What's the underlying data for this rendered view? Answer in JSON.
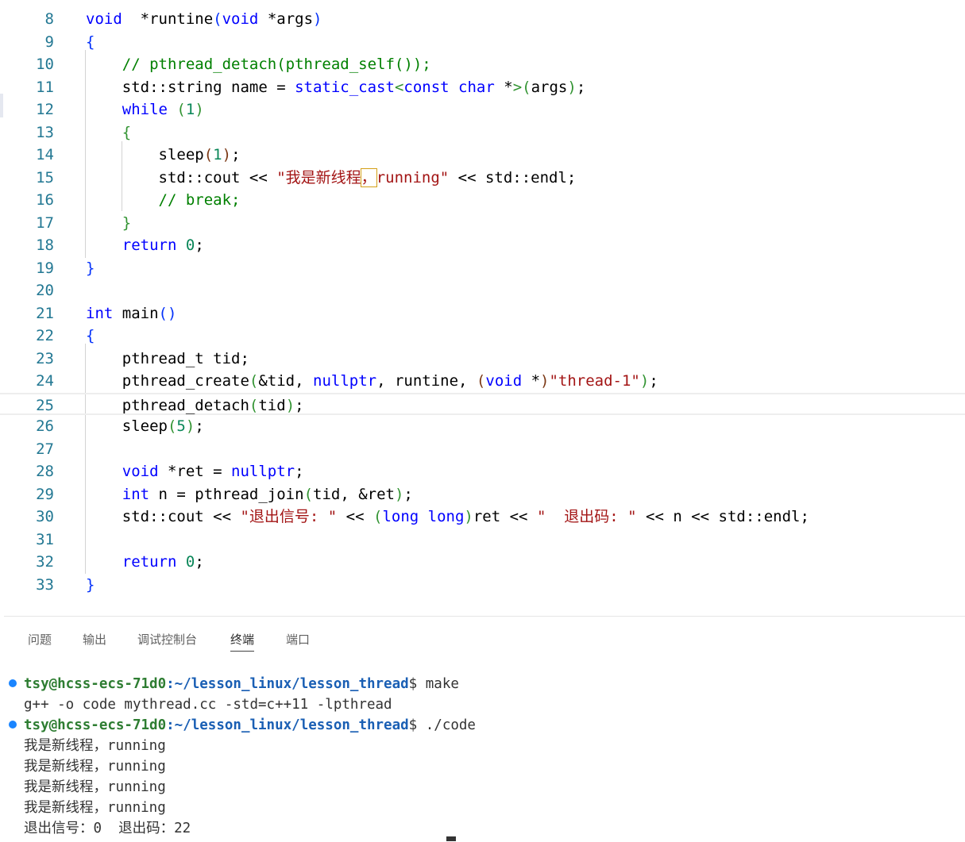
{
  "editor": {
    "lines": [
      {
        "n": "8",
        "tokens": [
          [
            "kw",
            "void"
          ],
          [
            "",
            "  *runtine"
          ],
          [
            "br1",
            "("
          ],
          [
            "kw",
            "void"
          ],
          [
            "",
            " *args"
          ],
          [
            "br1",
            ")"
          ]
        ]
      },
      {
        "n": "9",
        "tokens": [
          [
            "br1",
            "{"
          ]
        ]
      },
      {
        "n": "10",
        "tokens": [
          [
            "",
            "    "
          ],
          [
            "cm",
            "// pthread_detach(pthread_self());"
          ]
        ]
      },
      {
        "n": "11",
        "tokens": [
          [
            "",
            "    std::string name = "
          ],
          [
            "kw",
            "static_cast"
          ],
          [
            "br2",
            "<"
          ],
          [
            "kw",
            "const char"
          ],
          [
            "",
            " *"
          ],
          [
            "br2",
            ">"
          ],
          [
            "br2",
            "("
          ],
          [
            "",
            "args"
          ],
          [
            "br2",
            ")"
          ],
          [
            "",
            ";"
          ]
        ]
      },
      {
        "n": "12",
        "tokens": [
          [
            "",
            "    "
          ],
          [
            "kw",
            "while"
          ],
          [
            "",
            ""
          ],
          [
            "br2",
            " ("
          ],
          [
            "num",
            "1"
          ],
          [
            "br2",
            ")"
          ]
        ]
      },
      {
        "n": "13",
        "tokens": [
          [
            "",
            "    "
          ],
          [
            "br2",
            "{"
          ]
        ]
      },
      {
        "n": "14",
        "tokens": [
          [
            "",
            "        sleep"
          ],
          [
            "br3",
            "("
          ],
          [
            "num",
            "1"
          ],
          [
            "br3",
            ")"
          ],
          [
            "",
            ";"
          ]
        ]
      },
      {
        "n": "15",
        "tokens": [
          [
            "",
            "        std::cout << "
          ],
          [
            "str",
            "\"我是新线程"
          ],
          [
            "str sel",
            "，"
          ],
          [
            "str",
            "running\""
          ],
          [
            "",
            " << std::endl;"
          ]
        ]
      },
      {
        "n": "16",
        "tokens": [
          [
            "",
            "        "
          ],
          [
            "cm",
            "// break;"
          ]
        ]
      },
      {
        "n": "17",
        "tokens": [
          [
            "",
            "    "
          ],
          [
            "br2",
            "}"
          ]
        ]
      },
      {
        "n": "18",
        "tokens": [
          [
            "",
            "    "
          ],
          [
            "kw",
            "return"
          ],
          [
            "",
            " "
          ],
          [
            "num",
            "0"
          ],
          [
            "",
            ";"
          ]
        ]
      },
      {
        "n": "19",
        "tokens": [
          [
            "br1",
            "}"
          ]
        ]
      },
      {
        "n": "20",
        "tokens": []
      },
      {
        "n": "21",
        "tokens": [
          [
            "kw",
            "int"
          ],
          [
            "",
            " main"
          ],
          [
            "br1",
            "()"
          ]
        ]
      },
      {
        "n": "22",
        "tokens": [
          [
            "br1",
            "{"
          ]
        ]
      },
      {
        "n": "23",
        "tokens": [
          [
            "",
            "    pthread_t tid;"
          ]
        ]
      },
      {
        "n": "24",
        "tokens": [
          [
            "",
            "    pthread_create"
          ],
          [
            "br2",
            "("
          ],
          [
            "",
            "&tid, "
          ],
          [
            "kw",
            "nullptr"
          ],
          [
            "",
            ", runtine, "
          ],
          [
            "br3",
            "("
          ],
          [
            "kw",
            "void"
          ],
          [
            "",
            " *"
          ],
          [
            "br3",
            ")"
          ],
          [
            "str",
            "\"thread-1\""
          ],
          [
            "br2",
            ")"
          ],
          [
            "",
            ";"
          ]
        ]
      },
      {
        "n": "25",
        "tokens": [
          [
            "",
            "    pthread_detach"
          ],
          [
            "br2",
            "("
          ],
          [
            "",
            "tid"
          ],
          [
            "br2",
            ")"
          ],
          [
            "",
            ";"
          ]
        ]
      },
      {
        "n": "26",
        "tokens": [
          [
            "",
            "    sleep"
          ],
          [
            "br2",
            "("
          ],
          [
            "num",
            "5"
          ],
          [
            "br2",
            ")"
          ],
          [
            "",
            ";"
          ]
        ]
      },
      {
        "n": "27",
        "tokens": []
      },
      {
        "n": "28",
        "tokens": [
          [
            "",
            "    "
          ],
          [
            "kw",
            "void"
          ],
          [
            "",
            " *ret = "
          ],
          [
            "kw",
            "nullptr"
          ],
          [
            "",
            ";"
          ]
        ]
      },
      {
        "n": "29",
        "tokens": [
          [
            "",
            "    "
          ],
          [
            "kw",
            "int"
          ],
          [
            "",
            " n = pthread_join"
          ],
          [
            "br2",
            "("
          ],
          [
            "",
            "tid, &ret"
          ],
          [
            "br2",
            ")"
          ],
          [
            "",
            ";"
          ]
        ]
      },
      {
        "n": "30",
        "tokens": [
          [
            "",
            "    std::cout << "
          ],
          [
            "str",
            "\"退出信号: \""
          ],
          [
            "",
            " << "
          ],
          [
            "br2",
            "("
          ],
          [
            "kw",
            "long long"
          ],
          [
            "br2",
            ")"
          ],
          [
            "",
            "ret << "
          ],
          [
            "str",
            "\"  退出码: \""
          ],
          [
            "",
            " << n << std::endl;"
          ]
        ]
      },
      {
        "n": "31",
        "tokens": []
      },
      {
        "n": "32",
        "tokens": [
          [
            "",
            "    "
          ],
          [
            "kw",
            "return"
          ],
          [
            "",
            " "
          ],
          [
            "num",
            "0"
          ],
          [
            "",
            ";"
          ]
        ]
      },
      {
        "n": "33",
        "tokens": [
          [
            "br1",
            "}"
          ]
        ]
      }
    ],
    "current_line": "25"
  },
  "panel": {
    "tabs": [
      {
        "label": "问题",
        "active": false
      },
      {
        "label": "输出",
        "active": false
      },
      {
        "label": "调试控制台",
        "active": false
      },
      {
        "label": "终端",
        "active": true
      },
      {
        "label": "端口",
        "active": false
      }
    ]
  },
  "terminal": {
    "user_host": "tsy@hcss-ecs-71d0",
    "path": ":~/lesson_linux/lesson_thread",
    "prompt_symbol": "$",
    "cmd1": " make",
    "out1": "g++ -o code mythread.cc -std=c++11 -lpthread",
    "cmd2": " ./code",
    "outputs": [
      "我是新线程，running",
      "我是新线程，running",
      "我是新线程，running",
      "我是新线程，running",
      "退出信号：0  退出码：22"
    ]
  }
}
